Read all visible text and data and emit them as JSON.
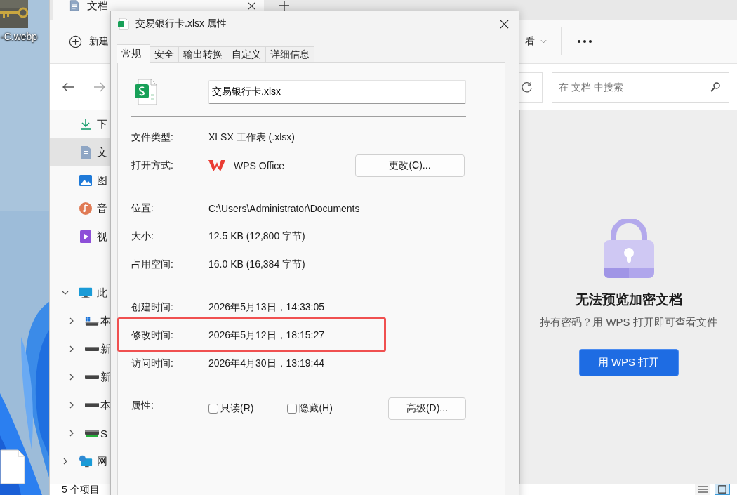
{
  "desktop": {
    "icon_label": "-C.webp"
  },
  "explorer": {
    "tab": {
      "title": "文档"
    },
    "toolbar": {
      "new_label": "新建",
      "view_label": "看"
    },
    "search": {
      "placeholder": "在 文档 中搜索"
    },
    "quick_access": [
      {
        "label": "下",
        "kind": "download",
        "selected": false
      },
      {
        "label": "文",
        "kind": "document",
        "selected": true
      },
      {
        "label": "图",
        "kind": "pictures",
        "selected": false
      },
      {
        "label": "音",
        "kind": "music",
        "selected": false
      },
      {
        "label": "视",
        "kind": "video",
        "selected": false
      }
    ],
    "tree": [
      {
        "label": "此",
        "kind": "computer",
        "expanded": true,
        "children": [
          {
            "label": "本",
            "kind": "system-drive",
            "expanded": false
          },
          {
            "label": "新",
            "kind": "drive",
            "expanded": false
          },
          {
            "label": "新",
            "kind": "drive",
            "expanded": false
          },
          {
            "label": "本",
            "kind": "drive",
            "expanded": false
          },
          {
            "label": "S",
            "kind": "usb-drive",
            "expanded": false
          }
        ]
      },
      {
        "label": "网",
        "kind": "network",
        "expanded": false
      }
    ],
    "status_bar": {
      "item_count": "5 个项目"
    },
    "view_buttons": [
      {
        "kind": "details",
        "selected": false
      },
      {
        "kind": "tiles",
        "selected": true
      }
    ],
    "preview": {
      "title": "无法预览加密文档",
      "message": "持有密码？用 WPS 打开即可查看文件",
      "button": "用 WPS 打开"
    }
  },
  "dialog": {
    "title": "交易银行卡.xlsx 属性",
    "tabs": [
      {
        "label": "常规",
        "selected": true
      },
      {
        "label": "安全",
        "selected": false
      },
      {
        "label": "输出转换",
        "selected": false
      },
      {
        "label": "自定义",
        "selected": false
      },
      {
        "label": "详细信息",
        "selected": false
      }
    ],
    "file_name": "交易银行卡.xlsx",
    "sections": [
      {
        "rows": [
          {
            "kind": "text",
            "label": "文件类型:",
            "value": "XLSX 工作表 (.xlsx)"
          },
          {
            "kind": "app",
            "label": "打开方式:",
            "value": "WPS Office",
            "button": "更改(C)..."
          }
        ]
      },
      {
        "rows": [
          {
            "kind": "text",
            "label": "位置:",
            "value": "C:\\Users\\Administrator\\Documents"
          },
          {
            "kind": "text",
            "label": "大小:",
            "value": "12.5 KB (12,800 字节)"
          },
          {
            "kind": "text",
            "label": "占用空间:",
            "value": "16.0 KB (16,384 字节)"
          }
        ]
      },
      {
        "rows": [
          {
            "kind": "text",
            "label": "创建时间:",
            "value": "2026年5月13日，14:33:05",
            "highlighted": false
          },
          {
            "kind": "text",
            "label": "修改时间:",
            "value": "2026年5月12日，18:15:27",
            "highlighted": true
          },
          {
            "kind": "text",
            "label": "访问时间:",
            "value": "2026年4月30日，13:19:44",
            "highlighted": false
          }
        ]
      }
    ],
    "attributes": {
      "label": "属性:",
      "options": [
        {
          "label": "只读(R)",
          "checked": false
        },
        {
          "label": "隐藏(H)",
          "checked": false
        }
      ],
      "button": "高级(D)..."
    }
  }
}
